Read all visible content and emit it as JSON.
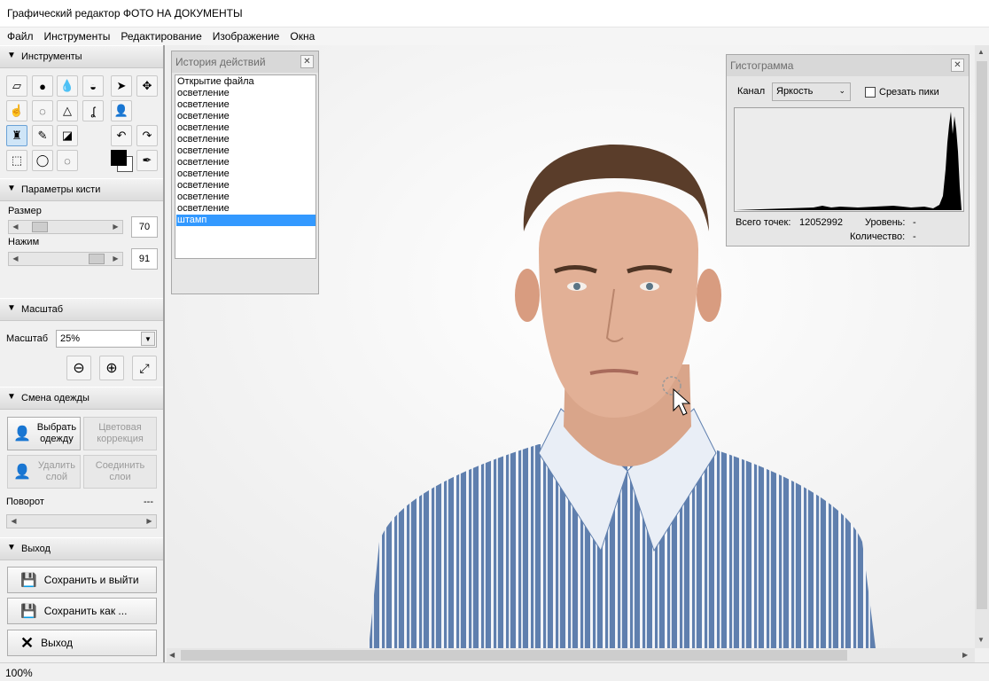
{
  "window_title": "Графический редактор ФОТО НА ДОКУМЕНТЫ",
  "menu": [
    "Файл",
    "Инструменты",
    "Редактирование",
    "Изображение",
    "Окна"
  ],
  "sidebar": {
    "tools_title": "Инструменты",
    "brush_title": "Параметры кисти",
    "size_label": "Размер",
    "size_value": "70",
    "pressure_label": "Нажим",
    "pressure_value": "91",
    "zoom_title": "Масштаб",
    "zoom_label": "Масштаб",
    "zoom_value": "25%",
    "clothes_title": "Смена одежды",
    "choose_clothes": "Выбрать одежду",
    "color_correction": "Цветовая коррекция",
    "delete_layer": "Удалить слой",
    "merge_layers": "Соединить слои",
    "rotation_label": "Поворот",
    "rotation_value": "---",
    "exit_title": "Выход",
    "save_exit": "Сохранить и выйти",
    "save_as": "Сохранить как ...",
    "exit": "Выход"
  },
  "history": {
    "title": "История действий",
    "items": [
      "Открытие файла",
      "осветление",
      "осветление",
      "осветление",
      "осветление",
      "осветление",
      "осветление",
      "осветление",
      "осветление",
      "осветление",
      "осветление",
      "осветление",
      "штамп"
    ],
    "selected_index": 12
  },
  "histogram": {
    "title": "Гистограмма",
    "channel_label": "Канал",
    "channel_value": "Яркость",
    "clip_label": "Срезать пики",
    "total_label": "Всего точек:",
    "total_value": "12052992",
    "level_label": "Уровень:",
    "level_value": "-",
    "count_label": "Количество:",
    "count_value": "-"
  },
  "status": {
    "zoom": "100%"
  },
  "colors": {
    "selection": "#3399ff",
    "foreground": "#000000",
    "background": "#ffffff"
  }
}
